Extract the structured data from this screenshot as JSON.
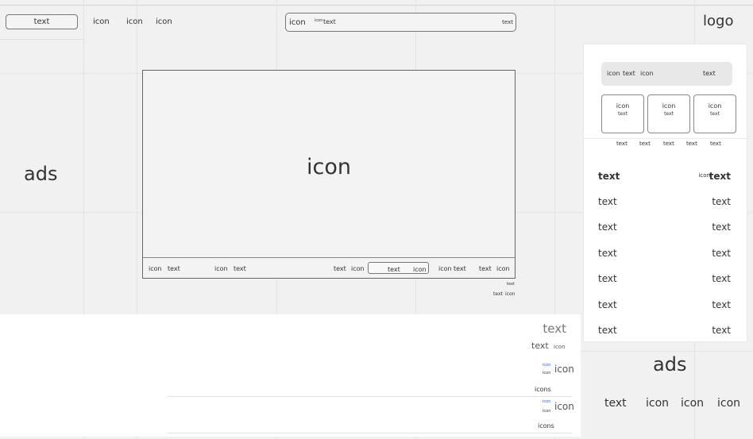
{
  "header": {
    "search_button_label": "text",
    "nav_icons": [
      "icon",
      "icon",
      "icon"
    ],
    "search": {
      "icon_label": "icon",
      "badge": "icon",
      "text": "text",
      "right_text": "text"
    },
    "logo": "logo"
  },
  "left_ad": {
    "label": "ads"
  },
  "video": {
    "center_icon": "icon",
    "controls": {
      "left_group": [
        "icon",
        "text",
        "icon",
        "text"
      ],
      "mid": [
        "text",
        "icon"
      ],
      "pill_text": "text",
      "pill_icon": "icon",
      "right_group": [
        "icon",
        "text",
        "text",
        "icon"
      ]
    },
    "below_small": "text",
    "below_pair": [
      "text",
      "icon"
    ]
  },
  "side_panel": {
    "bar": {
      "items": [
        "icon",
        "text",
        "icon"
      ],
      "right": "text"
    },
    "cards": [
      {
        "top": "icon",
        "sub": "text"
      },
      {
        "top": "icon",
        "sub": "text"
      },
      {
        "top": "icon",
        "sub": "text"
      }
    ],
    "card_labels": [
      "text",
      "text",
      "text",
      "text",
      "text"
    ],
    "list_header": {
      "left": "text",
      "icon": "icon",
      "right": "text"
    },
    "list_rows": [
      {
        "left": "text",
        "right": "text"
      },
      {
        "left": "text",
        "right": "text"
      },
      {
        "left": "text",
        "right": "text"
      },
      {
        "left": "text",
        "right": "text"
      },
      {
        "left": "text",
        "right": "text"
      },
      {
        "left": "text",
        "right": "text"
      }
    ]
  },
  "bottom_section": {
    "title": "text",
    "subtitle": "text",
    "subtitle_icon": "icon",
    "items": [
      {
        "mini1": "icon",
        "mini2": "icon",
        "icon": "icon",
        "caption": "icons"
      },
      {
        "mini1": "icon",
        "mini2": "icon",
        "icon": "icon",
        "caption": "icons"
      }
    ]
  },
  "right_ad": {
    "label": "ads",
    "footer": [
      "text",
      "icon",
      "icon",
      "icon"
    ]
  }
}
